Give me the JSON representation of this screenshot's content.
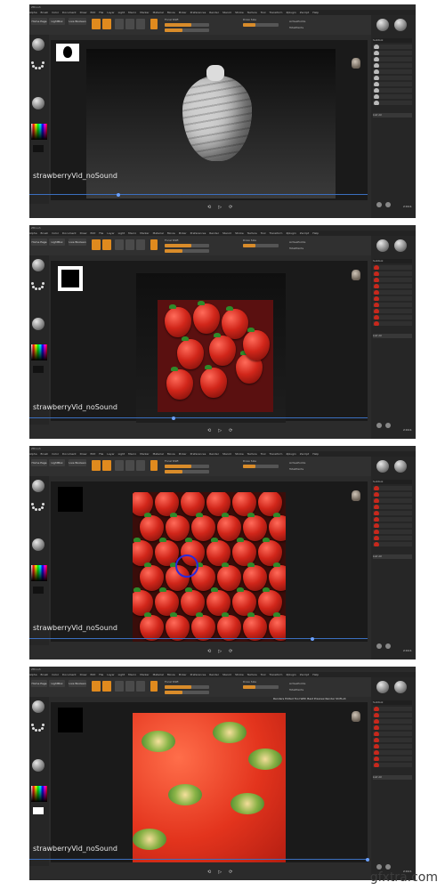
{
  "app": {
    "title": "ZBrush",
    "menu_items": [
      "Alpha",
      "Brush",
      "Color",
      "Document",
      "Draw",
      "Edit",
      "File",
      "Layer",
      "Light",
      "Macro",
      "Marker",
      "Material",
      "Movie",
      "Picker",
      "Preferences",
      "Render",
      "Stencil",
      "Stroke",
      "Texture",
      "Tool",
      "Transform",
      "Zplugin",
      "Zscript",
      "Help"
    ],
    "toolbar": {
      "home_page": "Home Page",
      "lightbox": "LightBox",
      "live_boolean": "Live Boolean",
      "focal_shift": "Focal Shift",
      "draw_size": "Draw Size",
      "active_points": "ActivePoints",
      "total_points": "TotalPoints"
    },
    "right_panel": {
      "subtool_label": "Subtool",
      "list_all": "List All"
    }
  },
  "panels": [
    {
      "video_title": "strawberryVid_noSound",
      "timecode": "2:04:1",
      "playback": [
        "⟲",
        "▷",
        "⟳"
      ],
      "content": "sculpt"
    },
    {
      "video_title": "strawberryVid_noSound",
      "timecode": "2:04:1",
      "playback": [
        "⟲",
        "▷",
        "⟳"
      ],
      "content": "strawberry-cluster"
    },
    {
      "video_title": "strawberryVid_noSound",
      "timecode": "2:04:1",
      "playback": [
        "⟲",
        "▷",
        "⟳"
      ],
      "content": "strawberry-tiles"
    },
    {
      "video_title": "strawberryVid_noSound",
      "timecode": "2:04:1",
      "playback": [
        "⟲",
        "▷",
        "⟳"
      ],
      "content": "strawberry-texture",
      "notice": "Renders Edited Tool With Best Preview Render  Shift+R"
    }
  ],
  "watermark": "gfxtra.com",
  "colors": {
    "accent": "#e08a1e",
    "panel_bg": "#2b2b2b",
    "timeline": "#3b6fbf",
    "strawberry_red": "#d1261a",
    "leaf_green": "#2f8a2a"
  }
}
